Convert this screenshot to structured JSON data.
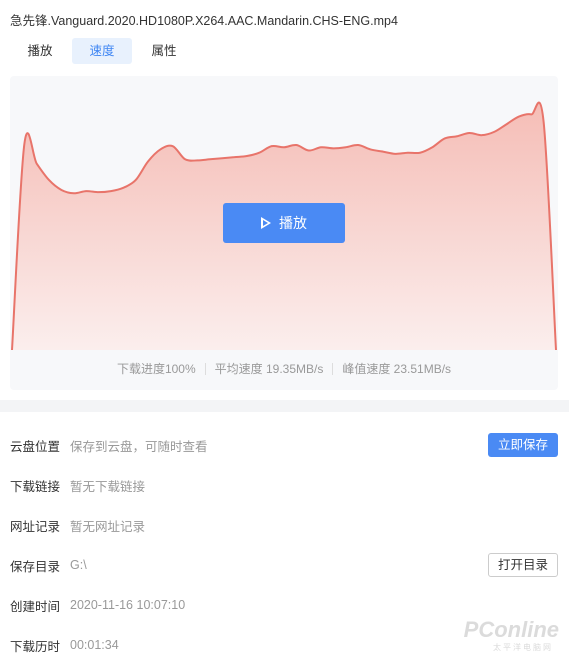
{
  "file": {
    "title": "急先锋.Vanguard.2020.HD1080P.X264.AAC.Mandarin.CHS-ENG.mp4"
  },
  "tabs": [
    {
      "label": "播放",
      "active": false
    },
    {
      "label": "速度",
      "active": true
    },
    {
      "label": "属性",
      "active": false
    }
  ],
  "play_button": {
    "label": "播放",
    "icon": "play-icon"
  },
  "stats": {
    "progress": "下载进度100%",
    "avg_speed": "平均速度 19.35MB/s",
    "peak_speed": "峰值速度 23.51MB/s"
  },
  "chart_data": {
    "type": "area",
    "title": "",
    "xlabel": "",
    "ylabel": "",
    "grid": false,
    "color": "#e8746a",
    "fill_top": "#f5bdb6",
    "fill_bottom": "#fbeeed",
    "ylim": [
      0,
      25
    ],
    "values": [
      0,
      18.8,
      17.0,
      15.5,
      14.6,
      14.3,
      14.5,
      14.4,
      14.5,
      14.8,
      15.5,
      17.2,
      18.3,
      18.6,
      17.4,
      17.3,
      17.4,
      17.5,
      17.6,
      17.7,
      18.0,
      18.6,
      18.5,
      18.7,
      18.2,
      18.5,
      18.4,
      18.5,
      18.7,
      18.3,
      18.1,
      17.9,
      18.0,
      18.0,
      18.5,
      19.3,
      19.5,
      19.8,
      19.6,
      19.9,
      20.6,
      21.3,
      21.5,
      20.8,
      0
    ]
  },
  "details": [
    {
      "label": "云盘位置",
      "value": "保存到云盘，可随时查看",
      "action": "立即保存"
    },
    {
      "label": "下载链接",
      "value": "暂无下载链接"
    },
    {
      "label": "网址记录",
      "value": "暂无网址记录"
    },
    {
      "label": "保存目录",
      "value": "G:\\",
      "action": "打开目录"
    },
    {
      "label": "创建时间",
      "value": "2020-11-16 10:07:10"
    },
    {
      "label": "下载历时",
      "value": "00:01:34"
    }
  ],
  "watermark": {
    "text": "PConline",
    "sub": "太平洋电脑网"
  }
}
